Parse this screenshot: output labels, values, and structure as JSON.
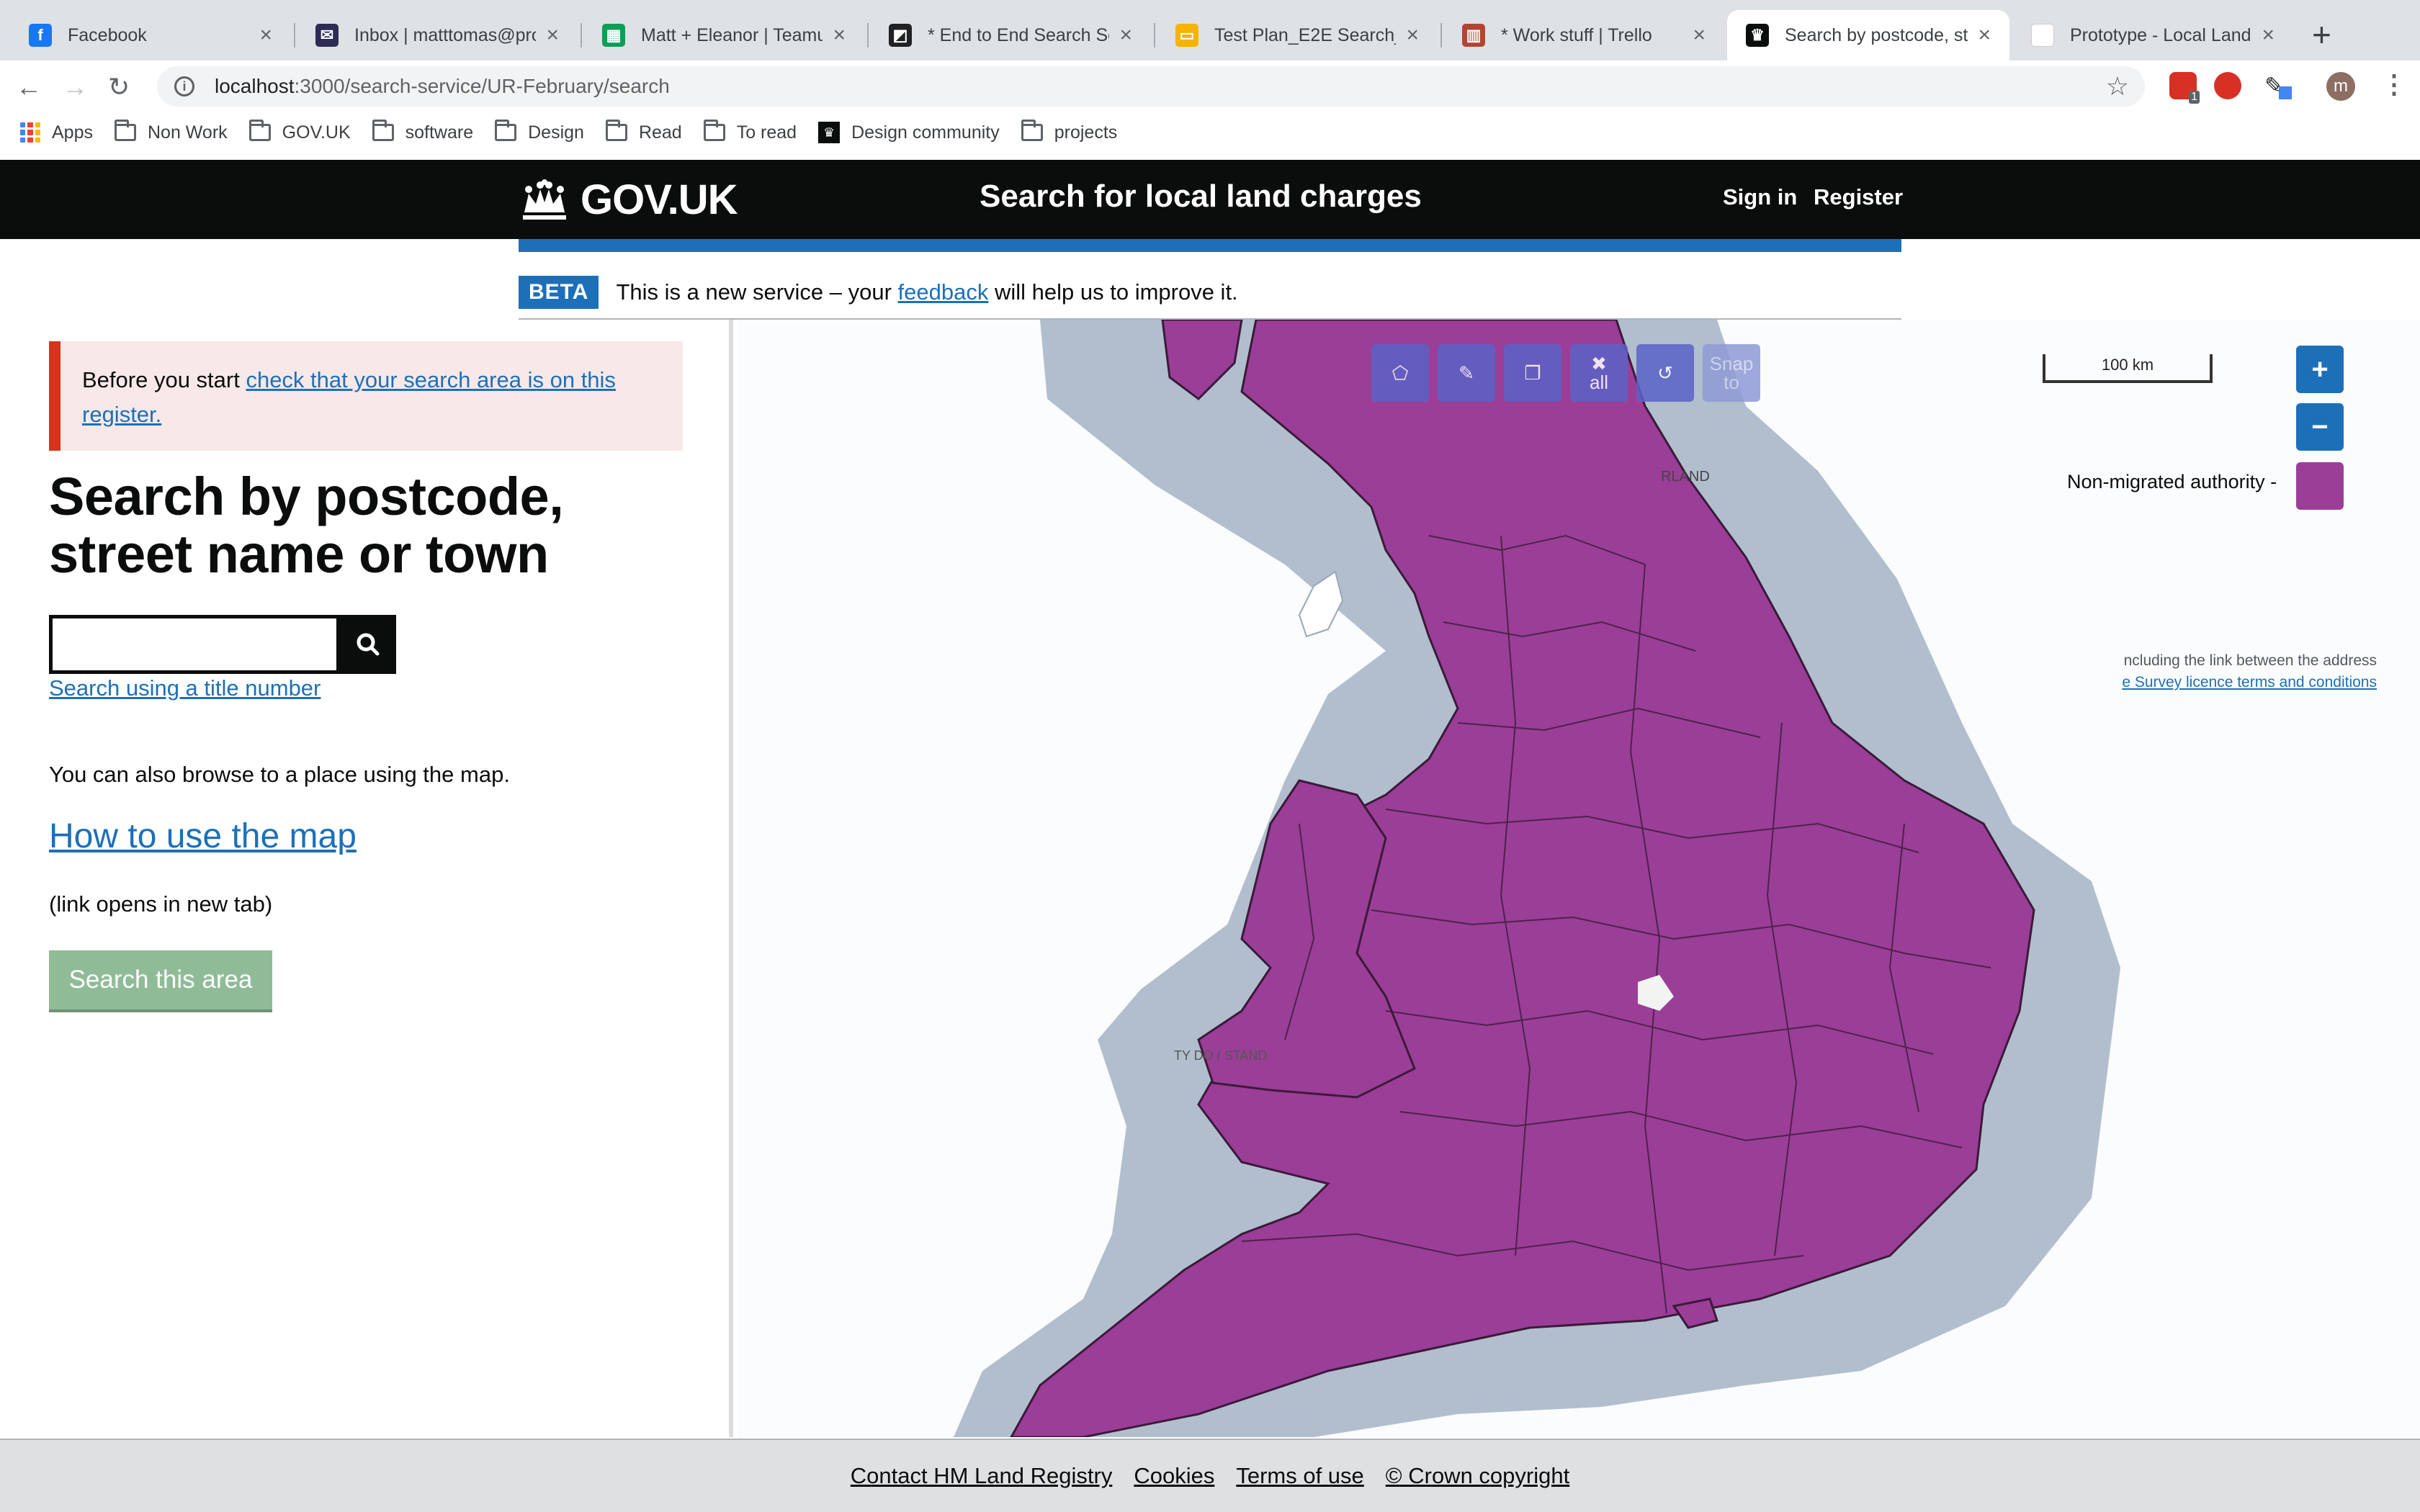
{
  "browser": {
    "tabs": [
      {
        "title": "Facebook",
        "icon": "facebook-icon",
        "color": "#1877f2",
        "glyph": "f"
      },
      {
        "title": "Inbox | matttomas@pro",
        "icon": "mail-icon",
        "color": "#2c2c54",
        "glyph": "✉"
      },
      {
        "title": "Matt + Eleanor | Teamu",
        "icon": "sheets-icon",
        "color": "#0f9d58",
        "glyph": "▦"
      },
      {
        "title": "* End to End Search Se",
        "icon": "doc-icon",
        "color": "#202124",
        "glyph": "◩"
      },
      {
        "title": "Test Plan_E2E Search_",
        "icon": "slides-icon",
        "color": "#f4b400",
        "glyph": "▭"
      },
      {
        "title": "* Work stuff | Trello",
        "icon": "trello-icon",
        "color": "#b04632",
        "glyph": "▥"
      },
      {
        "title": "Search by postcode, st",
        "icon": "crown-icon",
        "color": "#0b0c0c",
        "glyph": "♛",
        "active": true
      },
      {
        "title": "Prototype - Local Land",
        "icon": "blank-page-icon",
        "color": "#ffffff",
        "glyph": ""
      }
    ],
    "url_host": "localhost",
    "url_path": ":3000/search-service/UR-February/search",
    "bookmarks": [
      {
        "label": "Apps",
        "icon": "apps-icon"
      },
      {
        "label": "Non Work",
        "icon": "folder-icon"
      },
      {
        "label": "GOV.UK",
        "icon": "folder-icon"
      },
      {
        "label": "software",
        "icon": "folder-icon"
      },
      {
        "label": "Design",
        "icon": "folder-icon"
      },
      {
        "label": "Read",
        "icon": "folder-icon"
      },
      {
        "label": "To read",
        "icon": "folder-icon"
      },
      {
        "label": "Design community",
        "icon": "crown-icon"
      },
      {
        "label": "projects",
        "icon": "folder-icon"
      }
    ],
    "profile_initial": "m",
    "extension_badge": "1"
  },
  "header": {
    "logo_text": "GOV.UK",
    "service_name": "Search for local land charges",
    "sign_in": "Sign in",
    "register": "Register"
  },
  "phase": {
    "tag": "BETA",
    "text_before": "This is a new service – your ",
    "link": "feedback",
    "text_after": " will help us to improve it."
  },
  "sidebar": {
    "notice_before": "Before you start ",
    "notice_link": "check that your search area is on this register.",
    "heading": "Search by postcode, street name or town",
    "search_value": "",
    "title_link": "Search using a title number",
    "browse_text": "You can also browse to a place using the map.",
    "howto_link": "How to use the map",
    "newtab_note": "(link opens in new tab)",
    "search_area_button": "Search this area"
  },
  "map": {
    "tools": [
      {
        "name": "draw-polygon-tool",
        "glyph": "⬠"
      },
      {
        "name": "edit-tool",
        "glyph": "✎"
      },
      {
        "name": "copy-tool",
        "glyph": "❐"
      },
      {
        "name": "clear-all-tool",
        "glyph": "✖",
        "sub": "all"
      },
      {
        "name": "undo-tool",
        "glyph": "↺"
      },
      {
        "name": "snap-to-tool",
        "glyph": "Snap",
        "sub": "to",
        "muted": true
      }
    ],
    "scale_label": "100 km",
    "zoom_in": "+",
    "zoom_out": "−",
    "legend_label": "Non-migrated authority -",
    "legend_color": "#9b3e97",
    "land_color": "#9b3e97",
    "buffer_color": "#a8b7c9",
    "place_labels": [
      "RLAND",
      "TY DO / STAND"
    ],
    "attribution_text": "ncluding the link between the address",
    "attribution_link": "e Survey licence terms and conditions"
  },
  "footer": {
    "links": [
      "Contact HM Land Registry",
      "Cookies",
      "Terms of use",
      "© Crown copyright"
    ]
  }
}
